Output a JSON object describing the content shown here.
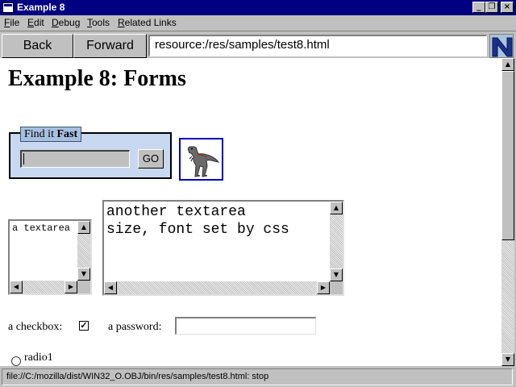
{
  "window": {
    "title": "Example 8"
  },
  "menu": {
    "items": [
      {
        "key": "F",
        "rest": "ile"
      },
      {
        "key": "E",
        "rest": "dit"
      },
      {
        "key": "D",
        "rest": "ebug"
      },
      {
        "key": "T",
        "rest": "ools"
      },
      {
        "key": "R",
        "rest": "elated Links"
      }
    ]
  },
  "toolbar": {
    "back_label": "Back",
    "forward_label": "Forward",
    "url": "resource:/res/samples/test8.html",
    "throbber_icon": "netscape-n-logo-icon"
  },
  "page": {
    "heading": "Example 8: Forms",
    "fieldset": {
      "legend_prefix": "Find it ",
      "legend_bold": "Fast",
      "input_value": "",
      "go_label": "GO"
    },
    "image_icon": "dinosaur-image-icon",
    "textarea1_value": "a textarea",
    "textarea2_value": "another textarea\nsize, font set by css",
    "checkbox_label": "a checkbox:",
    "checkbox_checked": true,
    "password_label": "a password:",
    "password_value": "",
    "radio_label": "radio1"
  },
  "statusbar": {
    "text": "file://C:/mozilla/dist/WIN32_O.OBJ/bin/res/samples/test8.html: stop"
  },
  "colors": {
    "titlebar": "#000080",
    "fieldset_bg": "#c8d8f0",
    "image_border": "#0000c0"
  }
}
